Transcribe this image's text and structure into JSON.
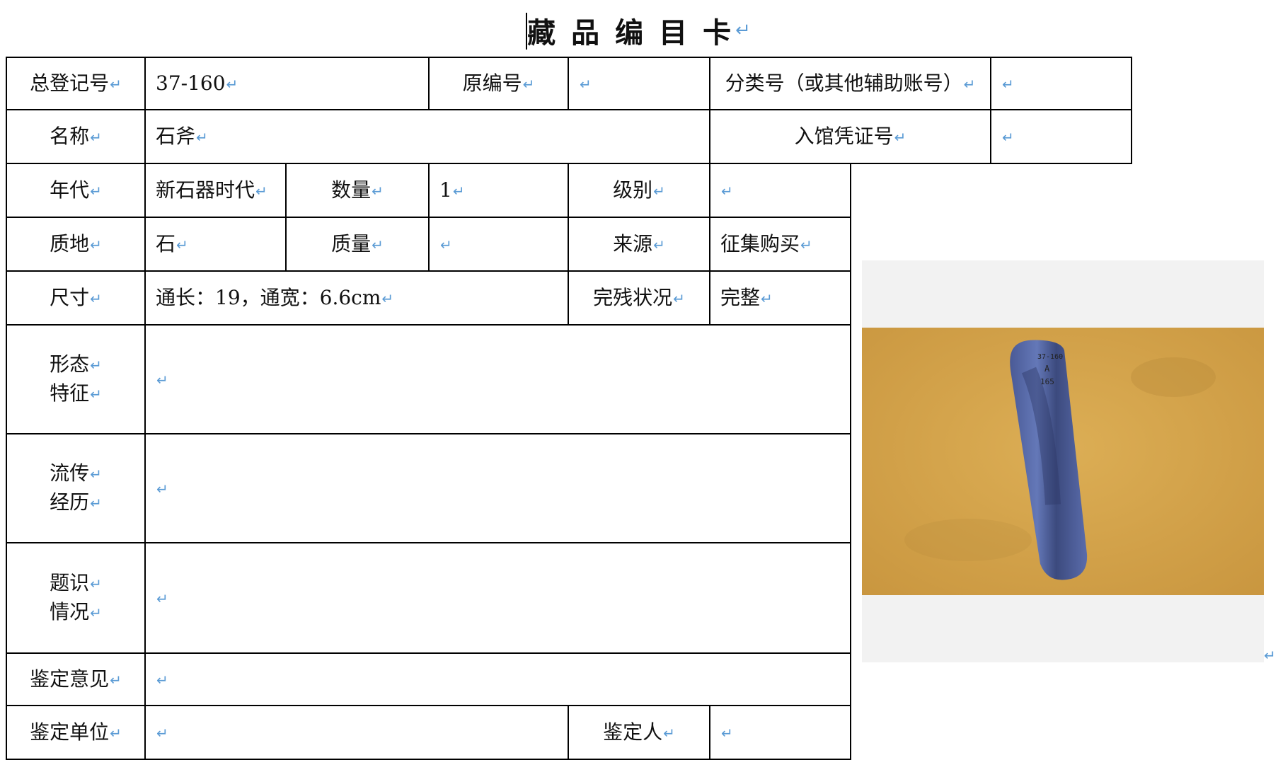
{
  "title": "藏品编目卡",
  "mark": "↵",
  "rows": {
    "reg": {
      "label": "总登记号",
      "value": "37-160"
    },
    "orig": {
      "label": "原编号",
      "value": ""
    },
    "cls": {
      "label": "分类号（或其他辅助账号）",
      "value": ""
    },
    "name": {
      "label": "名称",
      "value": "石斧"
    },
    "voucher": {
      "label": "入馆凭证号",
      "value": ""
    },
    "era": {
      "label": "年代",
      "value": "新石器时代"
    },
    "qty": {
      "label": "数量",
      "value": "1"
    },
    "grade": {
      "label": "级别",
      "value": ""
    },
    "material": {
      "label": "质地",
      "value": "石"
    },
    "mass": {
      "label": "质量",
      "value": ""
    },
    "source": {
      "label": "来源",
      "value": "征集购买"
    },
    "size": {
      "label": "尺寸",
      "value": "通长：19，通宽：6.6cm"
    },
    "condition": {
      "label": "完残状况",
      "value": "完整"
    },
    "form": {
      "label1": "形态",
      "label2": "特征",
      "value": ""
    },
    "history": {
      "label1": "流传",
      "label2": "经历",
      "value": ""
    },
    "inscr": {
      "label1": "题识",
      "label2": "情况",
      "value": ""
    },
    "opinion": {
      "label": "鉴定意见",
      "value": ""
    },
    "unit": {
      "label": "鉴定单位",
      "value": ""
    },
    "appraiser": {
      "label": "鉴定人",
      "value": ""
    }
  },
  "photo": {
    "label_line1": "37-160",
    "label_line2": "A",
    "label_line3": "165",
    "colors": {
      "background": "#d4a24a",
      "stone": "#5a6fae"
    }
  }
}
